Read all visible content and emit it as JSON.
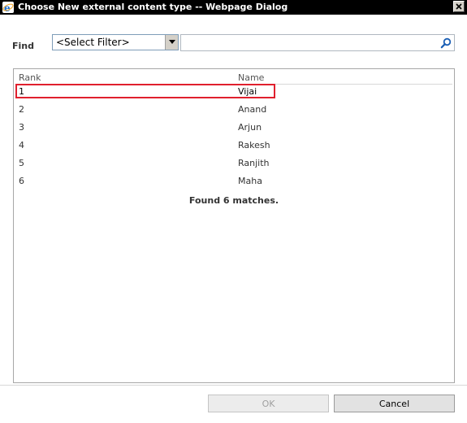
{
  "window": {
    "title": "Choose New external content type -- Webpage Dialog"
  },
  "find": {
    "label": "Find",
    "filter_selected": "<Select Filter>",
    "search_value": ""
  },
  "results": {
    "columns": [
      "Rank",
      "Name"
    ],
    "rows": [
      {
        "rank": "1",
        "name": "Vijai",
        "selected": true
      },
      {
        "rank": "2",
        "name": "Anand"
      },
      {
        "rank": "3",
        "name": "Arjun"
      },
      {
        "rank": "4",
        "name": "Rakesh"
      },
      {
        "rank": "5",
        "name": "Ranjith"
      },
      {
        "rank": "6",
        "name": "Maha"
      }
    ],
    "status": "Found 6 matches."
  },
  "buttons": {
    "ok": "OK",
    "cancel": "Cancel"
  },
  "colors": {
    "titlebar": "#000000",
    "highlight": "#e0202e"
  }
}
